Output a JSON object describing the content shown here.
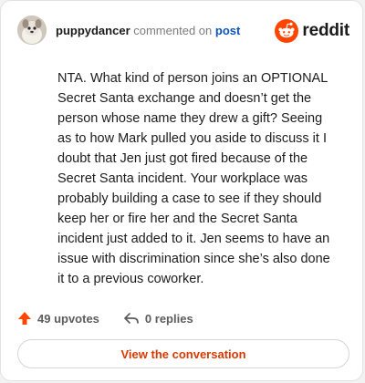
{
  "header": {
    "username": "puppydancer",
    "action_text": "commented on",
    "target": "post",
    "brand": "reddit"
  },
  "comment": {
    "body": "NTA. What kind of person joins an OPTIONAL Secret Santa exchange and doesn’t get the person whose name they drew a gift? Seeing as to how Mark pulled you aside to discuss it I doubt that Jen just got fired because of the Secret Santa incident. Your workplace was probably building a case to see if they should keep her or fire her and the Secret Santa incident just added to it. Jen seems to have an issue with discrimination since she’s also done it to a previous coworker."
  },
  "stats": {
    "upvotes_label": "49 upvotes",
    "replies_label": "0 replies"
  },
  "cta": {
    "label": "View the conversation"
  },
  "icons": {
    "avatar": "avatar-image",
    "logo": "reddit-snoo-icon",
    "upvote": "upvote-arrow-icon",
    "reply": "reply-arrow-icon"
  },
  "colors": {
    "brand": "#ff4500",
    "link": "#0b53b8",
    "cta_text": "#d93900"
  }
}
